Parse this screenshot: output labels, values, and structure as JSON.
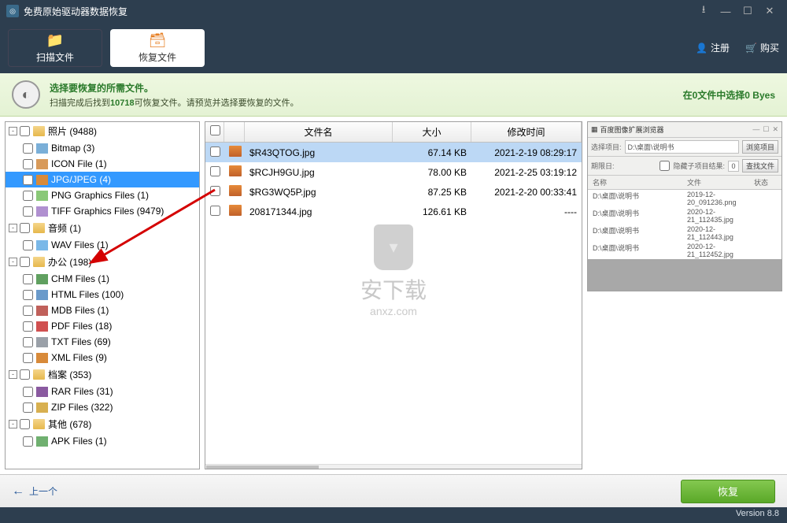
{
  "app_title": "免费原始驱动器数据恢复",
  "tabs": {
    "scan": "扫描文件",
    "recover": "恢复文件"
  },
  "top_links": {
    "register": "注册",
    "buy": "购买"
  },
  "instruction": {
    "title": "选择要恢复的所需文件。",
    "sub_pre": "扫描完成后找到",
    "count": "10718",
    "sub_post": "可恢复文件。请预览并选择要恢复的文件。",
    "status_pre": "在",
    "status_n": "0",
    "status_mid": "文件中选择",
    "status_bytes": "0 Byes"
  },
  "tree": [
    {
      "lvl": 0,
      "exp": "-",
      "ic": "ic-folder",
      "label": "照片 (9488)",
      "sel": false
    },
    {
      "lvl": 1,
      "ic": "ic-bmp",
      "label": "Bitmap (3)",
      "sel": false
    },
    {
      "lvl": 1,
      "ic": "ic-ico",
      "label": "ICON File (1)",
      "sel": false
    },
    {
      "lvl": 1,
      "ic": "ic-jpg",
      "label": "JPG/JPEG (4)",
      "sel": true
    },
    {
      "lvl": 1,
      "ic": "ic-png",
      "label": "PNG Graphics Files (1)",
      "sel": false
    },
    {
      "lvl": 1,
      "ic": "ic-tif",
      "label": "TIFF Graphics Files (9479)",
      "sel": false
    },
    {
      "lvl": 0,
      "exp": "-",
      "ic": "ic-folder",
      "label": "音频 (1)",
      "sel": false
    },
    {
      "lvl": 1,
      "ic": "ic-wav",
      "label": "WAV Files (1)",
      "sel": false
    },
    {
      "lvl": 0,
      "exp": "-",
      "ic": "ic-folder",
      "label": "办公 (198)",
      "sel": false
    },
    {
      "lvl": 1,
      "ic": "ic-chm",
      "label": "CHM Files (1)",
      "sel": false
    },
    {
      "lvl": 1,
      "ic": "ic-html",
      "label": "HTML Files (100)",
      "sel": false
    },
    {
      "lvl": 1,
      "ic": "ic-mdb",
      "label": "MDB Files (1)",
      "sel": false
    },
    {
      "lvl": 1,
      "ic": "ic-pdf",
      "label": "PDF Files (18)",
      "sel": false
    },
    {
      "lvl": 1,
      "ic": "ic-txt",
      "label": "TXT Files (69)",
      "sel": false
    },
    {
      "lvl": 1,
      "ic": "ic-xml",
      "label": "XML Files (9)",
      "sel": false
    },
    {
      "lvl": 0,
      "exp": "-",
      "ic": "ic-folder",
      "label": "档案 (353)",
      "sel": false
    },
    {
      "lvl": 1,
      "ic": "ic-rar",
      "label": "RAR Files (31)",
      "sel": false
    },
    {
      "lvl": 1,
      "ic": "ic-zip",
      "label": "ZIP Files (322)",
      "sel": false
    },
    {
      "lvl": 0,
      "exp": "-",
      "ic": "ic-folder",
      "label": "其他 (678)",
      "sel": false
    },
    {
      "lvl": 1,
      "ic": "ic-apk",
      "label": "APK Files (1)",
      "sel": false
    }
  ],
  "file_headers": {
    "name": "文件名",
    "size": "大小",
    "date": "修改时间"
  },
  "files": [
    {
      "name": "$R43QTOG.jpg",
      "size": "67.14 KB",
      "date": "2021-2-19 08:29:17",
      "sel": true
    },
    {
      "name": "$RCJH9GU.jpg",
      "size": "78.00 KB",
      "date": "2021-2-25 03:19:12",
      "sel": false
    },
    {
      "name": "$RG3WQ5P.jpg",
      "size": "87.25 KB",
      "date": "2021-2-20 00:33:41",
      "sel": false
    },
    {
      "name": "208171344.jpg",
      "size": "126.61 KB",
      "date": "----",
      "sel": false
    }
  ],
  "watermark": {
    "main": "安下载",
    "sub": "anxz.com"
  },
  "preview": {
    "title": "百度图像扩展浏览器",
    "path_label": "选择项目:",
    "path_value": "D:\\桌面\\说明书",
    "btn_browse": "浏览项目",
    "toolbar2_label": "期限日:",
    "toolbar2_chk": "隐藏子项目结果:",
    "toolbar2_n": "0",
    "toolbar2_btn": "查找文件",
    "cols": {
      "c1": "名称",
      "c2": "文件",
      "c3": "状态"
    },
    "rows": [
      {
        "a": "D:\\桌面\\说明书",
        "b": "2019-12-20_091236.png",
        "c": ""
      },
      {
        "a": "D:\\桌面\\说明书",
        "b": "2020-12-21_112435.jpg",
        "c": ""
      },
      {
        "a": "D:\\桌面\\说明书",
        "b": "2020-12-21_112443.jpg",
        "c": ""
      },
      {
        "a": "D:\\桌面\\说明书",
        "b": "2020-12-21_112452.jpg",
        "c": ""
      }
    ]
  },
  "bottom": {
    "prev": "上一个",
    "recover": "恢复"
  },
  "version": "Version 8.8"
}
